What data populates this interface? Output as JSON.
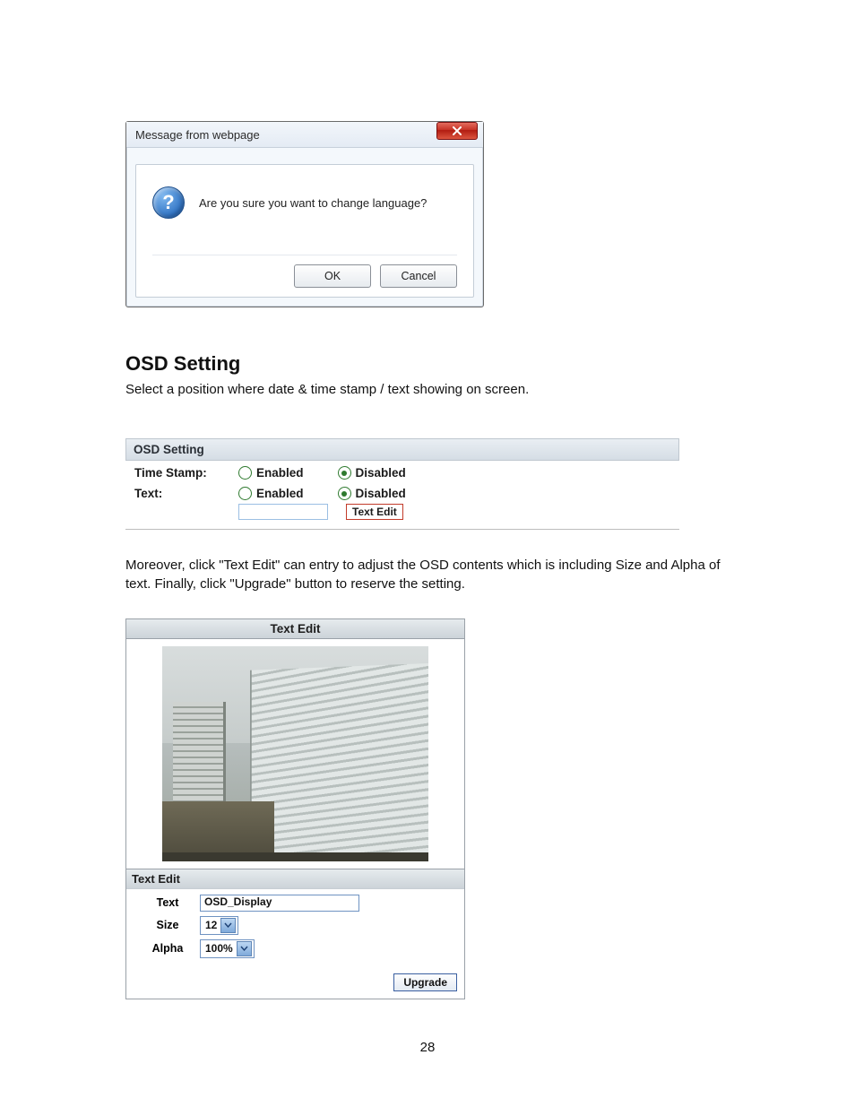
{
  "dialog": {
    "title": "Message from webpage",
    "question_glyph": "?",
    "message": "Are you sure you want to change language?",
    "ok_label": "OK",
    "cancel_label": "Cancel"
  },
  "heading": "OSD Setting",
  "heading_desc": "Select a position where date & time stamp / text showing on screen.",
  "osd_panel": {
    "title": "OSD Setting",
    "rows": {
      "timestamp": {
        "label": "Time Stamp:",
        "enabled": "Enabled",
        "disabled": "Disabled",
        "selected": "disabled"
      },
      "text": {
        "label": "Text:",
        "enabled": "Enabled",
        "disabled": "Disabled",
        "selected": "disabled"
      }
    },
    "tiny_input_value": "",
    "text_edit_button": "Text Edit"
  },
  "paragraph2": "Moreover, click \"Text Edit\" can entry to adjust the OSD contents which is including Size and Alpha of text. Finally, click \"Upgrade\" button to reserve the setting.",
  "text_edit_panel": {
    "title": "Text Edit",
    "subheader": "Text Edit",
    "fields": {
      "text": {
        "label": "Text",
        "value": "OSD_Display"
      },
      "size": {
        "label": "Size",
        "value": "12"
      },
      "alpha": {
        "label": "Alpha",
        "value": "100%"
      }
    },
    "upgrade_label": "Upgrade"
  },
  "page_number": "28"
}
